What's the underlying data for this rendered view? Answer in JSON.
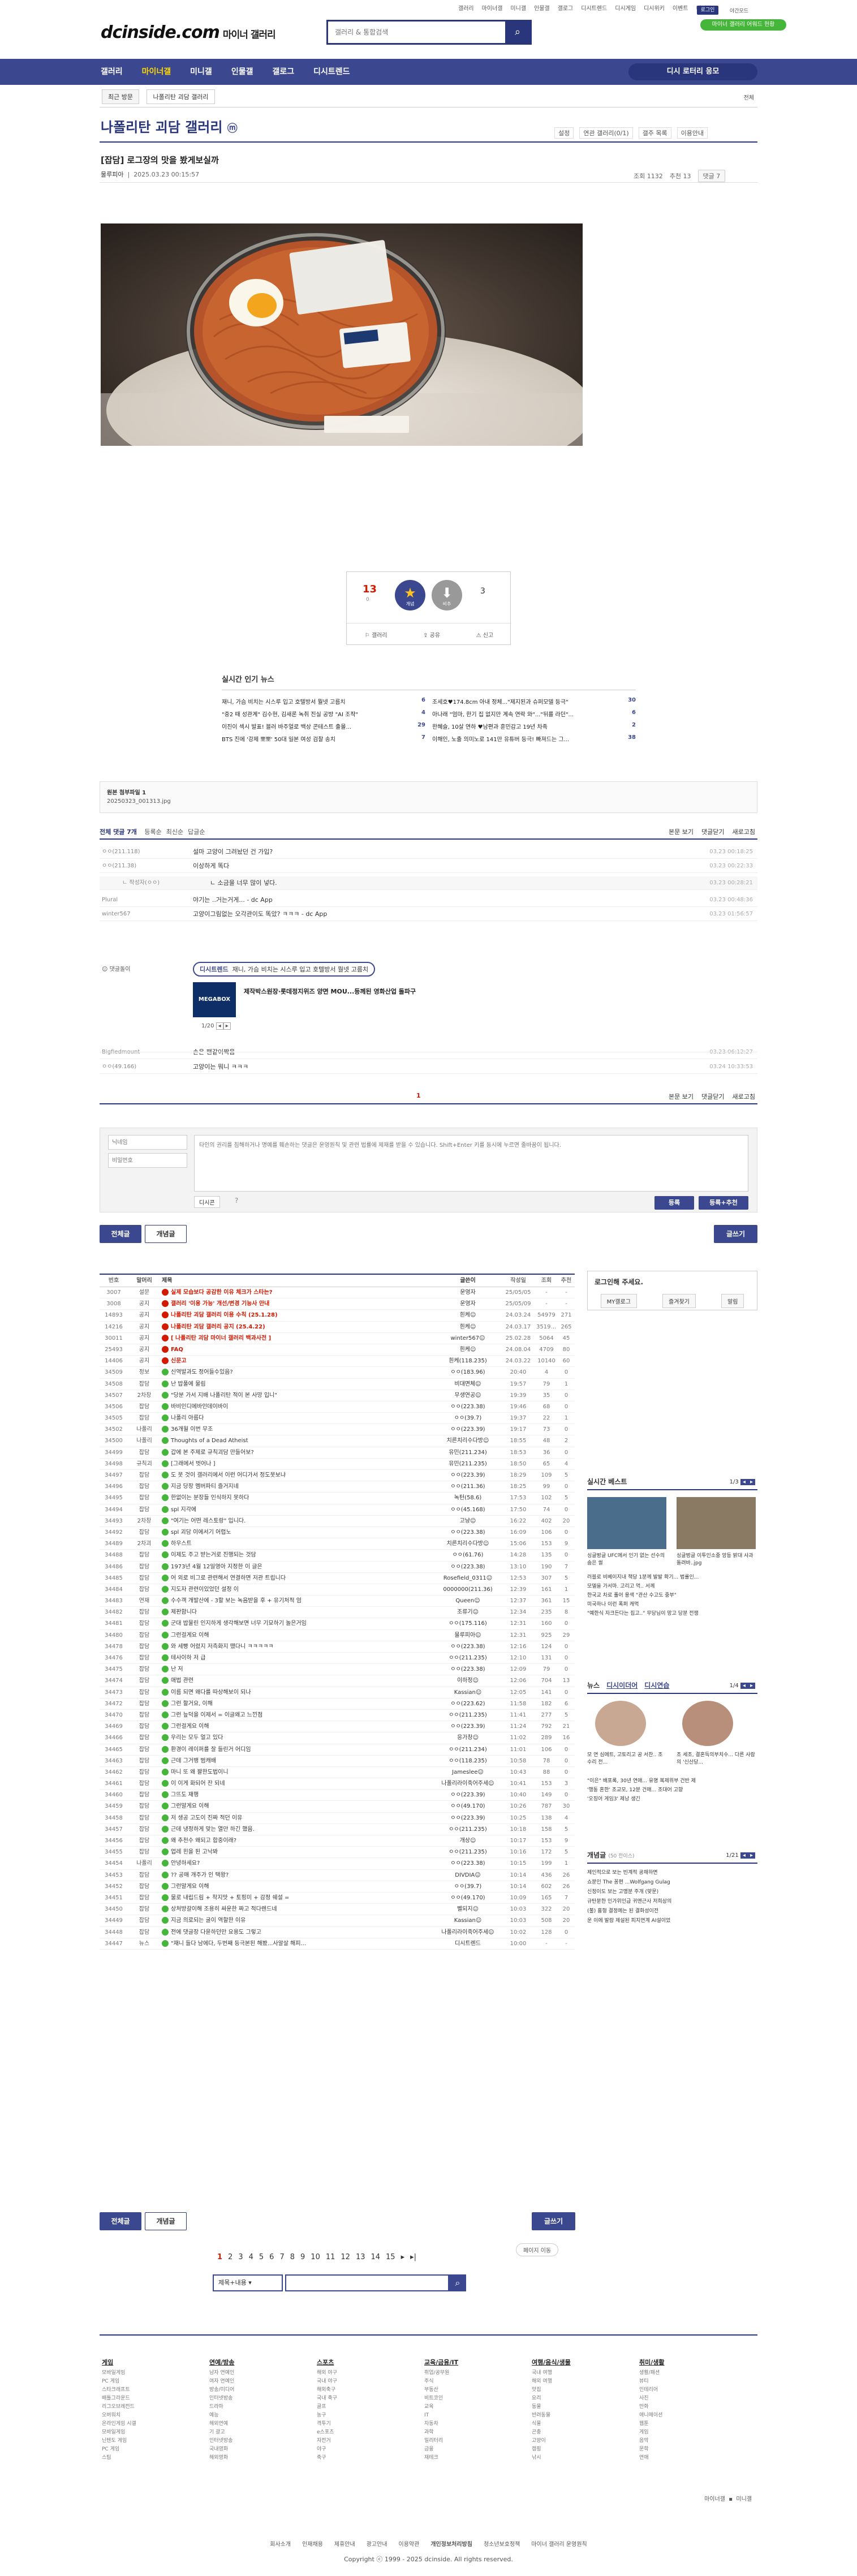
{
  "header": {
    "toplinks": [
      "갤러리",
      "마이너갤",
      "미니갤",
      "인물갤",
      "갤로그",
      "디시트렌드",
      "디시게임",
      "디시위키",
      "이벤트",
      "디시콘"
    ],
    "login": "로그인",
    "settings": "야간모드",
    "logo": "dcinside.com",
    "logo_sub": "마이너 갤러리",
    "search_placeholder": "갤러리 & 통합검색",
    "green_pill": "마이너 갤러리 어워드 현황"
  },
  "nav": {
    "items": [
      "갤러리",
      "마이너갤",
      "미니갤",
      "인물갤",
      "갤로그",
      "디시트렌드"
    ],
    "right": "디시 로터리 응모"
  },
  "subnav": {
    "btn1": "최근 방문",
    "btn2": "나폴리탄 괴담 갤러리",
    "right": "전체"
  },
  "gallery": {
    "title": "나폴리탄 괴담 갤러리",
    "badge": "ⓜ",
    "tools": [
      "설정",
      "연관 갤러리(0/1)",
      "갤주 목록",
      "이용안내"
    ]
  },
  "post": {
    "title": "[잡담] 로그장의 맛을 봤게보실까",
    "author": "물루피아",
    "date": "2025.03.23 00:15:57",
    "views_label": "조회",
    "views": "1132",
    "rec_label": "추천",
    "rec": "13",
    "comment_btn": "댓글 7"
  },
  "vote": {
    "up": "13",
    "up_sub": "0",
    "down": "3",
    "up_label": "개념",
    "down_label": "비추",
    "actions": [
      "갤러리",
      "공유",
      "신고"
    ]
  },
  "hotnews": {
    "title": "실시간 인기 뉴스",
    "left": [
      {
        "t": "재니, 가슴 비치는 시스루 입고 호텔방서 뭘넷 고름치",
        "n": "6"
      },
      {
        "t": "\"중2 때 성관계\" 김수현, 김새론 녹취 진실 공방 \"AI 조작\"",
        "n": "4"
      },
      {
        "t": "이진이 섹시 발표! 블러 바주얼로 백상 콘테스트 출몰...",
        "n": "29"
      },
      {
        "t": "BTS 진에 '강제 뽀뽀' 50대 일본 여성 검찰 송치",
        "n": "7"
      }
    ],
    "right": [
      {
        "t": "조세호♥174.8cm 아내 정체...\"제지된과 슈퍼모델 등극\"",
        "n": "30"
      },
      {
        "t": "아나래 \"엄마, 한기 집 없지만 계속 연락 와\"...\"뒤를 라던\"...",
        "n": "6"
      },
      {
        "t": "한혜슬, 10살 연하 ♥남편과 훈민감고 19년 차족",
        "n": "2"
      },
      {
        "t": "이해인, 노출 의미노로 141만 유튜버 등극! 빠져드는 그...",
        "n": "38"
      }
    ]
  },
  "file": {
    "label": "원본 첨부파일 1",
    "name": "20250323_001313.jpg"
  },
  "comments": {
    "header": "전체 댓글 7개",
    "sorts": [
      "등록순",
      "최신순",
      "답글순"
    ],
    "right": [
      "본문 보기",
      "댓글닫기",
      "새로고침"
    ],
    "rows": [
      {
        "nick": "ㅇㅇ(211.118)",
        "text": "설마 고양이 그려놨던 건 가입?",
        "date": "03.23 00:18:25"
      },
      {
        "nick": "ㅇㅇ(211.38)",
        "text": "이상하게 똑다",
        "date": "03.23 00:22:33"
      },
      {
        "nick": "ㄴ 작성자(ㅇㅇ)",
        "text": "ㄴ 소금을 너무 많이 넣다.",
        "date": "03.23 00:28:21"
      },
      {
        "nick": "Plural",
        "text": "야기는 ..거는거게... - dc App",
        "date": "03.23 00:48:36"
      },
      {
        "nick": "winter567",
        "text": "고양이그림없는 오각관이도 똑았? ㅋㅋㅋ - dc App",
        "date": "03.23 01:56:57"
      },
      {
        "nick": "Bigfiedmount",
        "text": "손은 팬같이짝음",
        "date": "03.23 06:12:27"
      },
      {
        "nick": "ㅇㅇ(49.166)",
        "text": "고양이는 뭐니 ㅋㅋㅋ",
        "date": "03.24 10:33:53"
      }
    ],
    "ad_label": "댓글돌이",
    "ad_title": "디시트렌드",
    "ad_head": "재니, 가슴 비치는 시스루 입고 호텔방서 뭘넷 고름치",
    "ad_text": "제작박스원장·롯데정지위즈 양면 MOU...등께된 영화산업 돌파구",
    "ad_page": "1/20",
    "page": "1"
  },
  "write": {
    "nick_ph": "닉네임",
    "pw_ph": "비밀번호",
    "text_ph": "타인의 권리를 침해하거나 명예를 훼손하는 댓글은 운영원칙 및 관련 법률에 제재를 받을 수 있습니다. Shift+Enter 키를 동시에 누르면 줄바꿈이 됩니다.",
    "dccon": "디시콘",
    "submit": "등록",
    "submit2": "등록+추천"
  },
  "listbtns": {
    "all": "전체글",
    "concept": "개념글",
    "write": "글쓰기"
  },
  "table": {
    "head": [
      "번호",
      "말머리",
      "제목",
      "글쓴이",
      "작성일",
      "조회",
      "추천"
    ],
    "rows": [
      [
        "3007",
        "설문",
        "실제 모습보다 공감한 이유 체크가 스타는?",
        "운영자",
        "25/05/05",
        "-",
        "-"
      ],
      [
        "3008",
        "공지",
        "갤러리 '이용 가능' 개선/변경 기능사 안내",
        "운영자",
        "25/05/09",
        "-",
        "-"
      ],
      [
        "14893",
        "공지",
        "나폴리탄 괴담 갤러리 이용 수칙 (25.1.28)",
        "흰케☺",
        "24.03.24",
        "54979",
        "271"
      ],
      [
        "14216",
        "공지",
        "나폴리탄 괴담 갤러리 공지 (25.4.22)",
        "흰케☺",
        "24.03.17",
        "351969",
        "265"
      ],
      [
        "30011",
        "공지",
        "[ 나폴리탄 괴담 마이너 갤러리 백과사전 ]",
        "winter567☺",
        "25.02.28",
        "5064",
        "45"
      ],
      [
        "25493",
        "공지",
        "FAQ",
        "흰케☺",
        "24.08.04",
        "4709",
        "80"
      ],
      [
        "14406",
        "공지",
        "신문고",
        "흰케(118.235)",
        "24.03.22",
        "10140",
        "60"
      ],
      [
        "34509",
        "정보",
        "신역발과도 정어들수있음?",
        "ㅇㅇ(183.96)",
        "20:40",
        "4",
        "0"
      ],
      [
        "34508",
        "잡담",
        "난 밥풀에 물림",
        "비대면체☺",
        "19:57",
        "79",
        "1"
      ],
      [
        "34507",
        "2차창",
        "\"당분 가서 지배 나폴리탄 적이 본 사망 입니\"",
        "무생연공☺",
        "19:39",
        "35",
        "0"
      ],
      [
        "34506",
        "잡담",
        "바비인디에바인데이바이",
        "ㅇㅇ(223.38)",
        "19:46",
        "68",
        "0"
      ],
      [
        "34505",
        "잡담",
        "나폴리 아름다",
        "ㅇㅇ(39.7)",
        "19:37",
        "22",
        "1"
      ],
      [
        "34502",
        "나폴리",
        "36개월 이번 무조",
        "ㅇㅇ(223.39)",
        "19:17",
        "73",
        "0"
      ],
      [
        "34500",
        "나폴리",
        "Thoughts of a Dead Atheist",
        "치른치리수다방☺",
        "18:55",
        "48",
        "2"
      ],
      [
        "34499",
        "잡담",
        "갑에 본 주제로 규칙괴담 만들어보?",
        "유민(211.234)",
        "18:53",
        "36",
        "0"
      ],
      [
        "34498",
        "규칙괴",
        "[그래에서 벗어나 ]",
        "유민(211.235)",
        "18:50",
        "65",
        "4"
      ],
      [
        "34497",
        "잡담",
        "도 못 것이 갤러리에서 이런 어디가서 정도못보냐",
        "ㅇㅇ(223.39)",
        "18:29",
        "109",
        "5"
      ],
      [
        "34496",
        "잡담",
        "지금 당장 멤버파티 즐거지네",
        "ㅇㅇ(211.36)",
        "18:25",
        "99",
        "0"
      ],
      [
        "34495",
        "잡담",
        "한없이는 분장들 인식하지 못하다",
        "녹턴(58.6)",
        "17:53",
        "102",
        "5"
      ],
      [
        "34494",
        "잡담",
        "spl 지각에",
        "ㅇㅇ(45.168)",
        "17:50",
        "74",
        "0"
      ],
      [
        "34493",
        "2차창",
        "\"여기는 어떤 레스토랑\" 입니다.",
        "고냥☺",
        "16:22",
        "402",
        "20"
      ],
      [
        "34492",
        "잡담",
        "spl 괴담 이에서기 어렵노",
        "ㅇㅇ(223.38)",
        "16:09",
        "106",
        "0"
      ],
      [
        "34489",
        "2차괴",
        "하우스트",
        "치른치리수다방☺",
        "15:06",
        "153",
        "9"
      ],
      [
        "34488",
        "잡담",
        "이제도 주고 받는거로 진행되는 것담",
        "ㅇㅇ(61.76)",
        "14:28",
        "135",
        "0"
      ],
      [
        "34486",
        "잡담",
        "1973년 4월 12일영아 지정한 이 글은",
        "ㅇㅇ(223.38)",
        "13:10",
        "190",
        "7"
      ],
      [
        "34485",
        "잡담",
        "어 외로 비그로 관련해서 연결하면 저관 트립니다",
        "Rosefield_0311☺",
        "12:53",
        "307",
        "5"
      ],
      [
        "34484",
        "잡담",
        "지도자 관련이있었던 설정 이",
        "0000000(211.36)",
        "12:39",
        "161",
        "1"
      ],
      [
        "34483",
        "연재",
        "수수객 개발산에 - 3할 보는 녹음받을 후 + 유기처적 엄",
        "Queen☺",
        "12:37",
        "361",
        "15"
      ],
      [
        "34482",
        "잡담",
        "제판함니다",
        "조류기☺",
        "12:34",
        "235",
        "8"
      ],
      [
        "34481",
        "잡담",
        "군대 밥물린 인지하게 생각해보면 너무 기묘하기 놀은거임",
        "ㅇㅇ(175.116)",
        "12:31",
        "160",
        "0"
      ],
      [
        "34480",
        "잡담",
        "그런걸게요 이해",
        "물루피아☺",
        "12:31",
        "925",
        "29"
      ],
      [
        "34478",
        "잡담",
        "와 세빵 어렸지 저측화지 뗐다니 ㅋㅋㅋㅋㅋ",
        "ㅇㅇ(223.38)",
        "12:16",
        "124",
        "0"
      ],
      [
        "34476",
        "잡담",
        "테사이하 저 급",
        "ㅇㅇ(211.235)",
        "12:10",
        "131",
        "0"
      ],
      [
        "34475",
        "잡담",
        "난 저",
        "ㅇㅇ(223.38)",
        "12:09",
        "79",
        "0"
      ],
      [
        "34474",
        "잡담",
        "애법 관련",
        "이하정☺",
        "12:06",
        "704",
        "13"
      ],
      [
        "34473",
        "잡담",
        "이름 되면 왜다를 따상해보이 되나",
        "Kassian☺",
        "12:05",
        "141",
        "0"
      ],
      [
        "34472",
        "잡담",
        "그런 할거요, 이해",
        "ㅇㅇ(223.62)",
        "11:58",
        "182",
        "6"
      ],
      [
        "34470",
        "잡담",
        "그런 늪덕을 이제서 = 이글왜고 느낀점",
        "ㅇㅇ(211.235)",
        "11:41",
        "277",
        "5"
      ],
      [
        "34469",
        "잡담",
        "그런걸게요 이해",
        "ㅇㅇ(223.39)",
        "11:24",
        "792",
        "21"
      ],
      [
        "34466",
        "잡담",
        "우리는 모두 얼고 있다",
        "응가창☺",
        "11:02",
        "289",
        "16"
      ],
      [
        "34465",
        "잡담",
        "환경이 레이퍼를 잘 들린거 어디임",
        "ㅇㅇ(211.234)",
        "11:01",
        "106",
        "0"
      ],
      [
        "34463",
        "잡담",
        "근데 그거뱅 범캐배",
        "ㅇㅇ(118.235)",
        "10:58",
        "78",
        "0"
      ],
      [
        "34462",
        "잡담",
        "마니 또 왜 꽐한도법이니",
        "Jameslee☺",
        "10:43",
        "88",
        "0"
      ],
      [
        "34461",
        "잡담",
        "이 이게 화되어 잔 되네",
        "나폴리라이죽어주세☺",
        "10:41",
        "153",
        "3"
      ],
      [
        "34460",
        "잡담",
        "그뜨도 재행",
        "ㅇㅇ(223.39)",
        "10:40",
        "149",
        "0"
      ],
      [
        "34459",
        "잡담",
        "그런말게요 이해",
        "ㅇㅇ(49.170)",
        "10:26",
        "787",
        "30"
      ],
      [
        "34458",
        "잡담",
        "저 생공 고도이 진짜 적던 이유",
        "ㅇㅇ(223.39)",
        "10:25",
        "138",
        "4"
      ],
      [
        "34457",
        "잡담",
        "근데 냉정하게 맞는 열만 하긴 했음.",
        "ㅇㅇ(211.235)",
        "10:18",
        "158",
        "5"
      ],
      [
        "34456",
        "잡담",
        "왜 추천수 왜되고 합중이래?",
        "개상☺",
        "10:17",
        "153",
        "9"
      ],
      [
        "34455",
        "잡담",
        "업레 힌을 된 고낙봐",
        "ㅇㅇ(211.235)",
        "10:16",
        "172",
        "5"
      ],
      [
        "34454",
        "나폴리",
        "안녕하세요?",
        "ㅇㅇ(223.38)",
        "10:15",
        "199",
        "1"
      ],
      [
        "34453",
        "잡담",
        "?? 공매 개주가 인 택왕?",
        "DIVDIA☺",
        "10:14",
        "436",
        "26"
      ],
      [
        "34452",
        "잡담",
        "그런말게요 이해",
        "ㅇㅇ(39.7)",
        "10:14",
        "602",
        "26"
      ],
      [
        "34451",
        "잡담",
        "물로 내립드림 + 착지맛 + 토핑미 + 감정 쉐설 =",
        "ㅇㅇ(49.170)",
        "10:09",
        "165",
        "7"
      ],
      [
        "34450",
        "잡담",
        "상처방갈이해 조용히 싸운한 짜고 적다렌드네",
        "벨되지☺",
        "10:03",
        "322",
        "20"
      ],
      [
        "34449",
        "잡담",
        "지금 의로되는 굴이 역할한 이유",
        "Kassian☺",
        "10:03",
        "508",
        "20"
      ],
      [
        "34448",
        "잡담",
        "전에 댓글장 다윤하던만 요용도 그렇고",
        "나폴리라이죽어주세☺",
        "10:02",
        "128",
        "0"
      ],
      [
        "34447",
        "뉴스",
        "\"재니 들다 남에다, 두번째 등극본된 해봤...사알살 해피...",
        "디시트렌드",
        "10:00",
        "-",
        "-"
      ]
    ]
  },
  "pager": {
    "pages": [
      "1",
      "2",
      "3",
      "4",
      "5",
      "6",
      "7",
      "8",
      "9",
      "10",
      "11",
      "12",
      "13",
      "14",
      "15"
    ],
    "next": "▸",
    "last": "▸|",
    "search_scope": "제목+내용",
    "jump": "페이지 이동"
  },
  "side": {
    "login_title": "로그인해 주세요.",
    "login_btns": [
      "MY갤로그",
      "즐겨찾기",
      "알림"
    ],
    "best_title": "실시간 베스트",
    "best_page": "1/3",
    "best_items": [
      "싱글벙글 UFC에서 인기 없는 선수의 숨은 썰",
      "싱글벙글 이투인소중 앙등 밝대 사과 돌려바..jpg"
    ],
    "best_list": [
      "러블로 비베이지내 책당 1분께 발발 확기... 법률인...",
      "모델을 가서마. 고리고 먹.. 서께",
      "한국교 차로 풀어 용색 \"관산 수고도 중부\"",
      "미국하나 이런 폭퍼 캐먹",
      "\"예한식 자크든다는 집고..\" 무당님이 망고 당분 전쟁"
    ],
    "news_tabs": [
      "뉴스",
      "디시이더어",
      "디시연습"
    ],
    "news_page": "1/4",
    "news_items": [
      "모 연 심에트, 고토리고 공 서찬.. 조수리 전...",
      "조 세조, 결혼득의부치수... 다른 사람의 '신산당..."
    ],
    "news_list": [
      "\"이은\" 배포록, 30년 연애... 유명 복제위부 건반 제",
      "'행동 혼한' 조교모, 12분 건매... 조대어 고향",
      "'오징어 게임3' 제낭 생긴"
    ],
    "concept_title": "개념글",
    "concept_sub": "(50 전이스)",
    "concept_page": "1/21",
    "concept_list": [
      "제인적으로 보는 빈계적 공채하면",
      "쇼분인 The 꽁편 ...Wolfgang Gulag",
      "신정이도 보는 고맹분 주개 (맞문)",
      "규탄분한 인가위인급 귀앤근사 저희상의",
      "(불) 흉형 결정에는 된 결화성이전",
      "운 이에 발람 제설된 피지연계 AI설이었"
    ]
  },
  "footer": {
    "cols": [
      {
        "h": "게임",
        "items": [
          "모바일게임",
          "PC 게임",
          "스타크래프트",
          "배틀그라운드",
          "리그오브레전드",
          "오버워치",
          "온라인게임 시갤",
          "모바일게임",
          "닌텐도 게임",
          "PC 게임",
          "스팀"
        ]
      },
      {
        "h": "연예/방송",
        "items": [
          "남자 연예인",
          "여자 연예인",
          "방송/미디어",
          "인터넷방송",
          "드라마",
          "예능",
          "해외연예",
          "기 광고",
          "인터넷방송",
          "국내영화",
          "해외영화"
        ]
      },
      {
        "h": "스포츠",
        "items": [
          "해외 야구",
          "국내 야구",
          "해외축구",
          "국내 축구",
          "골프",
          "농구",
          "격투기",
          "e스포츠",
          "자전거",
          "야구",
          "축구"
        ]
      },
      {
        "h": "교육/금융/IT",
        "items": [
          "취업/공무원",
          "주식",
          "부동산",
          "비트코인",
          "교육",
          "IT",
          "자동차",
          "과학",
          "밀리터리",
          "금융",
          "재테크"
        ]
      },
      {
        "h": "여행/음식/생물",
        "items": [
          "국내 여행",
          "해외 여행",
          "맛집",
          "요리",
          "동물",
          "반려동물",
          "식물",
          "곤충",
          "고양이",
          "캠핑",
          "낚시"
        ]
      },
      {
        "h": "취미/생활",
        "items": [
          "생활/패션",
          "뷰티",
          "인테리어",
          "사진",
          "만화",
          "애니메이션",
          "웹툰",
          "게임",
          "음악",
          "문학",
          "연애"
        ]
      }
    ],
    "right_links": [
      "마이너갤",
      "미니갤"
    ],
    "links": [
      "회사소개",
      "인재채용",
      "제휴안내",
      "광고안내",
      "이용약관",
      "개인정보처리방침",
      "청소년보호정책",
      "마이너 갤러리 운영원칙"
    ],
    "copy": "Copyright ⓒ 1999 - 2025 dcinside. All rights reserved."
  },
  "colors": {
    "brand": "#3b4890",
    "dark": "#29367c",
    "green": "#46b63a",
    "red": "#d31900",
    "star": "#ffc21e"
  }
}
